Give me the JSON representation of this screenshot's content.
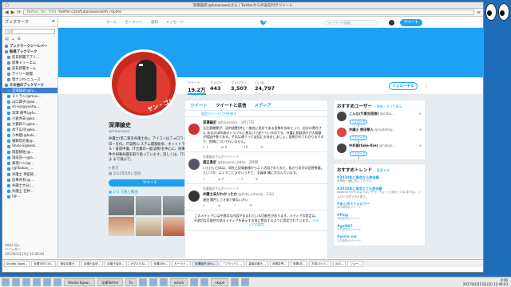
{
  "window": {
    "title": "深澤諭史(@fukasawa)さん | Twitterからの返信付きツイート",
    "url_secure": "Twitter, Inc. [US]",
    "url": "twitter.com/fukasawas/with_replies"
  },
  "sidebar": {
    "title": "ブックマーク",
    "search_placeholder": "検索",
    "items": [
      {
        "label": "ブックマークツールバー",
        "type": "folder"
      },
      {
        "label": "新規ブックマーク",
        "type": "folder"
      },
      {
        "label": "前日新聞アプリ...",
        "type": "item"
      },
      {
        "label": "無事トリーエム",
        "type": "item"
      },
      {
        "label": "前日新聞ホーム",
        "type": "item"
      },
      {
        "label": "デイリー新聞",
        "type": "item"
      },
      {
        "label": "理ナンfo-ニュース",
        "type": "item"
      },
      {
        "label": "その他のブックマーク",
        "type": "folder"
      },
      {
        "label": "深澤諭史(@fu...",
        "type": "tw",
        "selected": true
      },
      {
        "label": "ミトラン(@mux...",
        "type": "tw"
      },
      {
        "label": "山口典子(@ak...",
        "type": "tw"
      },
      {
        "label": "sh-ko(@yosho...",
        "type": "tw"
      },
      {
        "label": "深澤 耕平(@fu...",
        "type": "tw"
      },
      {
        "label": "小倉秀夫(@ko...",
        "type": "tw"
      },
      {
        "label": "大賀新人(@ka...",
        "type": "tw"
      },
      {
        "label": "木下広司(@ko...",
        "type": "tw"
      },
      {
        "label": "小林基(@kuki...",
        "type": "tw"
      },
      {
        "label": "検察官の後@...",
        "type": "tw"
      },
      {
        "label": "Sholo Egawa(...",
        "type": "tw"
      },
      {
        "label": "岡愛桃佐(@...",
        "type": "tw"
      },
      {
        "label": "浅海浩一(@a...",
        "type": "tw"
      },
      {
        "label": "真理ハン(@...",
        "type": "tw"
      },
      {
        "label": "(@Tsukas_...",
        "type": "tw"
      },
      {
        "label": "弁護士 神田知...",
        "type": "tw"
      },
      {
        "label": "記事共有(@...",
        "type": "tw"
      },
      {
        "label": "弁護士大分(...",
        "type": "tw"
      },
      {
        "label": "弁護士 石井...",
        "type": "tw"
      },
      {
        "label": "(@...",
        "type": "tw"
      }
    ],
    "footer_items": [
      "https://ja...",
      "ツイッター"
    ],
    "footer_time": "2017年2月13日 12:48:43"
  },
  "twitter": {
    "nav": [
      "ホーム",
      "モーメント",
      "通知",
      "メッセージ"
    ],
    "search_placeholder": "キーワード検索",
    "tweet_button": "ツイート",
    "stats": [
      {
        "label": "ツイート",
        "value": "19.2万"
      },
      {
        "label": "フォロー",
        "value": "443"
      },
      {
        "label": "フォロワー",
        "value": "3,507"
      },
      {
        "label": "いいね",
        "value": "24,797"
      }
    ],
    "follow_button": "フォローする",
    "more_icon": "⋮",
    "avatar_text": "ヤン・ゴジ",
    "profile": {
      "name": "深澤諭史",
      "handle": "@fukasawa",
      "bio": "弁護士(第二東京弁護士会)。アイコンはフォロワーの日ーを作。IT法務(システム開発紛争、ネットトラブル・誹謗中傷、IT企業の一般法務)を中心に、刑事事件や刑事弁護を取り扱っています。詳しくは、ITは頼よ まで飛ぶで。",
      "location": "東京",
      "joined": "2012年9月に登録",
      "tweet_to": "ツイート",
      "media": "171 写真と動画"
    },
    "timeline": {
      "tabs": [
        "ツイート",
        "ツイートと返信",
        "メディア"
      ],
      "pinned_link": "固定ツイートに付を使る",
      "tweets": [
        {
          "retweeted_by": "",
          "name": "深澤諭史",
          "meta": "@fukasawa · 3月17日",
          "body": "法注意機関が、法的措置(特に一般的に見対である投稿を含めとって、自分の責任さん あなのほ所者のトラブルに巻ないで述べているのです。弁護に相談頂けが大幅量が相談件数である。それは違うって返信にも存在しましょ。説明かれてわかりますので、投稿について行いません。",
          "actions": [
            "1",
            "9",
            "18"
          ]
        },
        {
          "retweeted_by": "深澤諭史さんがリツイート",
          "name": "渡辺勇史",
          "meta": "@tgryoiuu_bdea · 2時間",
          "body": "いとけい日本は、同社と記場者様からよく活用されておた、私から気付の回答数量。といつか、よくすこにませいうぞと、全員取 構に方なんでいます。",
          "actions": [
            "",
            "6",
            "3"
          ]
        },
        {
          "retweeted_by": "深澤諭史さんがリツイート",
          "name": "弁護士未だわかったか",
          "meta": "@kida_aduiuly · 23分",
          "body": "違途 関門してき発で質ないかい",
          "actions": [
            "",
            "",
            ""
          ]
        }
      ],
      "warning": "このメディアには不適切な内容が含まれている可能性があります。メディアの設定は、不適切な可能性のあるメディアを表示する前に警告するように設定されています。",
      "warning_link": "メディアの設定"
    },
    "right": {
      "suggest_title": "おすすめユーザー",
      "suggest_links": "・更新・すべて表示",
      "suggestions": [
        {
          "name": "こんなげ(愛児見隊)",
          "handle": "@cdba...",
          "follow": "フォローする"
        },
        {
          "name": "弁護士 野田隼人",
          "handle": "@nodahay...",
          "follow": "フォローする"
        },
        {
          "name": "中杉雅(fuke-fire)",
          "handle": "@nakas...",
          "follow": "フォローする"
        }
      ],
      "trends_title": "おすすめトレンド",
      "trends_link": "・変更する",
      "trends": [
        {
          "name": "#2020年に東京から旅歩集",
          "sub": "予想を一緒に出して下さい"
        },
        {
          "name": "#2020年に東京とても旅歩集",
          "sub": "AbemaTVからのようなさそう、ちょっと手伝ってね!ますは、フォローお付で手を振で..."
        },
        {
          "name": "#あと何でフォロワー",
          "sub": "3000件のツイート"
        },
        {
          "name": "#Ping",
          "sub": "18万件のツイート"
        },
        {
          "name": "#gal907",
          "sub": "1.5万件のツイート"
        },
        {
          "name": "#pizza_nw",
          "sub": "1.3万件のツイート"
        }
      ]
    }
  },
  "tabs": [
    "Shodai Egaw...",
    "深澤TWIT-Sh...",
    "東京弁護士...",
    "弁護士会@...",
    "弁護士会@...",
    "#ダメだね...",
    "深澤(@d...",
    "ろーライ...",
    "深澤諭史(@fu...",
    "「ブラック」...",
    "森倫弁護士...",
    "深澤名誉...",
    "深澤(@...",
    "お前のヒミ...",
    "山の...",
    "ショー..."
  ],
  "os_taskbar": {
    "buttons": [
      "",
      "",
      "",
      "",
      "",
      "",
      "Shodai Egaw...",
      "深澤Twitter",
      "Ta",
      "",
      "",
      "",
      "w/lock",
      "",
      "",
      "skype",
      "",
      ""
    ],
    "clock_time": "9:06",
    "clock_date": "2017年2月13日(月) 12:48:43"
  }
}
